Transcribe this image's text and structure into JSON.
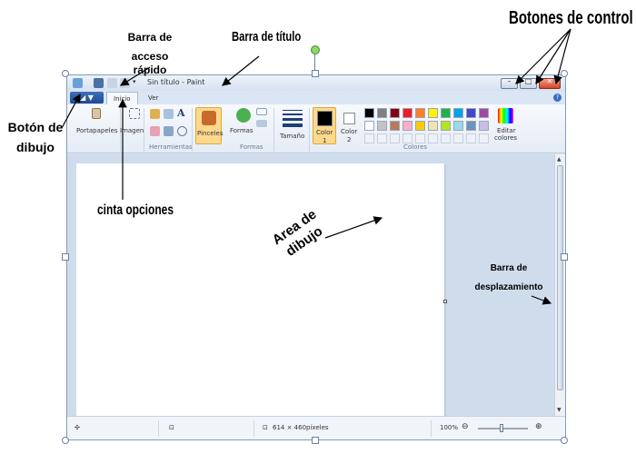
{
  "window": {
    "title": "Sin título - Paint",
    "controls": {
      "minimize": "–",
      "maximize": "□",
      "close": "✕"
    }
  },
  "tabs": {
    "paint_button": "▼",
    "inicio": "Inicio",
    "ver": "Ver",
    "help": "?"
  },
  "ribbon": {
    "portapapeles": "Portapapeles",
    "imagen": "Imagen",
    "herramientas": "Herramientas",
    "pinceles": "Pinceles",
    "formas": "Formas",
    "formas_group": "Formas",
    "tamano": "Tamaño",
    "color1": "Color",
    "color1_num": "1",
    "color2": "Color",
    "color2_num": "2",
    "colores": "Colores",
    "editar1": "Editar",
    "editar2": "colores",
    "palette_row1": [
      "#000000",
      "#7f7f7f",
      "#880015",
      "#ed1c24",
      "#ff7f27",
      "#fff200",
      "#22b14c",
      "#00a2e8",
      "#3f48cc",
      "#a349a4"
    ],
    "palette_row2": [
      "#ffffff",
      "#c3c3c3",
      "#b97a57",
      "#ffaec9",
      "#ffc90e",
      "#efe4b0",
      "#b5e61d",
      "#99d9ea",
      "#7092be",
      "#c8bfe7"
    ]
  },
  "status": {
    "size": "614 × 460píxeles",
    "zoom": "100%",
    "zoom_minus": "⊖",
    "zoom_plus": "⊕"
  },
  "annotations": {
    "barra_acceso_1": "Barra de",
    "barra_acceso_2": "acceso rápido",
    "barra_titulo": "Barra de título",
    "botones_control": "Botones de control",
    "boton_dibujo_1": "Botón de",
    "boton_dibujo_2": "dibujo",
    "cinta_opciones": "cinta opciones",
    "area_dibujo_1": "Area de",
    "area_dibujo_2": "dibujo",
    "barra_desp_1": "Barra de",
    "barra_desp_2": "desplazamiento"
  }
}
